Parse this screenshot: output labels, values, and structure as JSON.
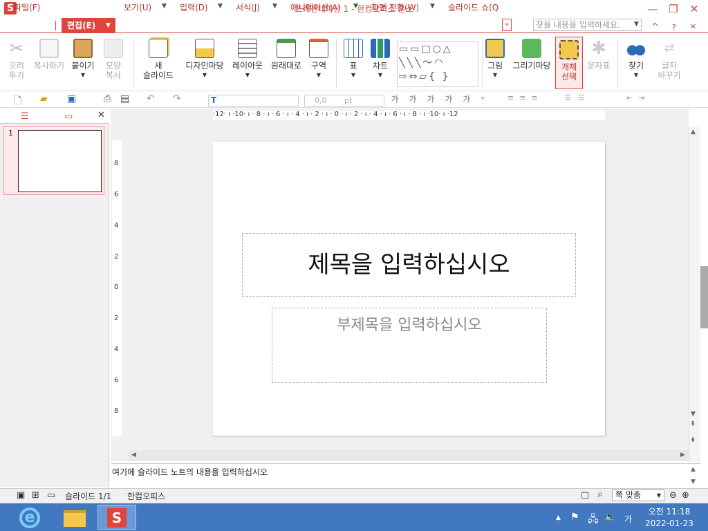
{
  "window": {
    "title": "프레젠테이션 1 - 한컴오피스 훈소",
    "logo_letter": "S",
    "controls": {
      "minimize": "—",
      "maximize": "❐",
      "close": "✕"
    }
  },
  "menu": {
    "items": [
      {
        "label": "파일(F)",
        "x": "file"
      },
      {
        "label": "편집(E)",
        "x": "edit"
      },
      {
        "label": "보기(U)",
        "x": "view"
      },
      {
        "label": "입력(D)",
        "x": "input"
      },
      {
        "label": "서식(J)",
        "x": "format"
      },
      {
        "label": "애니메이션(A)",
        "x": "animation"
      },
      {
        "label": "화면 전환(W)",
        "x": "transition"
      },
      {
        "label": "슬라이드 쇼(Q",
        "x": "slideshow"
      }
    ],
    "search_placeholder": "찾을 내용을 입력하세요.",
    "right_icons": {
      "up": "^",
      "help": "?",
      "close": "✕"
    }
  },
  "ribbon": {
    "cut": "오려\n두기",
    "copy": "복사하기",
    "paste": "붙이기",
    "format_copy": "모양\n복사",
    "new_slide": "새\n슬라이드",
    "design_madang": "디자인마당",
    "layout": "레이아웃",
    "reset": "원래대로",
    "section": "구역",
    "table": "표",
    "chart": "차트",
    "picture": "그림",
    "drawing_madang": "그리기마당",
    "object_select": "개체\n선택",
    "char_table": "문자표",
    "find": "찾기",
    "replace": "글자\n바꾸기"
  },
  "toolbar2": {
    "font_size_value": "0,0",
    "font_size_unit": "pt"
  },
  "left_panel": {
    "slide_number": "1"
  },
  "ruler": {
    "horizontal": "·12· ı ·10· ı · 8 · ı · 6 · ı · 4 · ı · 2 · ı · 0 · ı · 2 · ı · 4 · ı · 6 · ı · 8 · ı ·10· ı ·12",
    "vertical": [
      "8",
      "6",
      "4",
      "2",
      "0",
      "2",
      "4",
      "6",
      "8"
    ]
  },
  "slide": {
    "title_placeholder": "제목을 입력하십시오",
    "subtitle_placeholder": "부제목을 입력하십시오"
  },
  "notes": {
    "placeholder": "여기에 슬라이드 노트의 내용을 입력하십시오"
  },
  "status": {
    "slide_count": "슬라이드 1/1",
    "app_name": "한컴오피스",
    "zoom": "쪽 맞춤"
  },
  "taskbar": {
    "time": "오전 11:18",
    "date": "2022-01-23",
    "ime": "가"
  },
  "colors": {
    "accent": "#e0453b",
    "taskbar": "#4178c0"
  }
}
